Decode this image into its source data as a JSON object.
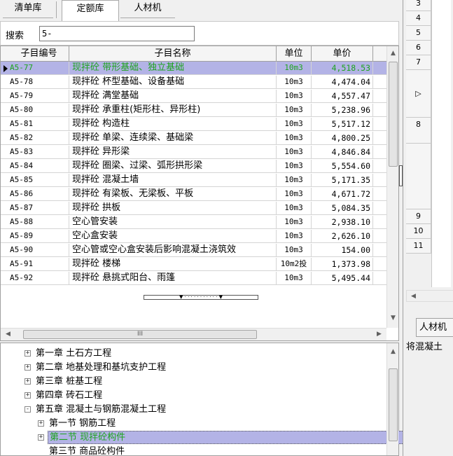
{
  "tabs": {
    "items": [
      "清单库",
      "定额库",
      "人材机"
    ],
    "active": 1
  },
  "search": {
    "label": "搜索",
    "value": "5-"
  },
  "grid": {
    "columns": [
      "子目编号",
      "子目名称",
      "单位",
      "单价"
    ],
    "selected_index": 0,
    "rows": [
      {
        "code": "A5-77",
        "name": "现拌砼 带形基础、独立基础",
        "unit": "10m3",
        "price": "4,518.53"
      },
      {
        "code": "A5-78",
        "name": "现拌砼 杯型基础、设备基础",
        "unit": "10m3",
        "price": "4,474.04"
      },
      {
        "code": "A5-79",
        "name": "现拌砼 满堂基础",
        "unit": "10m3",
        "price": "4,557.47"
      },
      {
        "code": "A5-80",
        "name": "现拌砼 承重柱(矩形柱、异形柱)",
        "unit": "10m3",
        "price": "5,238.96"
      },
      {
        "code": "A5-81",
        "name": "现拌砼 构造柱",
        "unit": "10m3",
        "price": "5,517.12"
      },
      {
        "code": "A5-82",
        "name": "现拌砼 单梁、连续梁、基础梁",
        "unit": "10m3",
        "price": "4,800.25"
      },
      {
        "code": "A5-83",
        "name": "现拌砼 异形梁",
        "unit": "10m3",
        "price": "4,846.84"
      },
      {
        "code": "A5-84",
        "name": "现拌砼 圈梁、过梁、弧形拱形梁",
        "unit": "10m3",
        "price": "5,554.60"
      },
      {
        "code": "A5-85",
        "name": "现拌砼 混凝土墙",
        "unit": "10m3",
        "price": "5,171.35"
      },
      {
        "code": "A5-86",
        "name": "现拌砼 有梁板、无梁板、平板",
        "unit": "10m3",
        "price": "4,671.72"
      },
      {
        "code": "A5-87",
        "name": "现拌砼 拱板",
        "unit": "10m3",
        "price": "5,084.35"
      },
      {
        "code": "A5-88",
        "name": "空心管安装",
        "unit": "10m3",
        "price": "2,938.10"
      },
      {
        "code": "A5-89",
        "name": "空心盒安装",
        "unit": "10m3",
        "price": "2,626.10"
      },
      {
        "code": "A5-90",
        "name": "空心管或空心盒安装后影响混凝土浇筑效",
        "unit": "10m3",
        "price": "154.00"
      },
      {
        "code": "A5-91",
        "name": "现拌砼 楼梯",
        "unit": "10m2投",
        "price": "1,373.98"
      },
      {
        "code": "A5-92",
        "name": "现拌砼 悬挑式阳台、雨篷",
        "unit": "10m3",
        "price": "5,495.44"
      }
    ],
    "hscroll_thumb_label": "III"
  },
  "tree": {
    "nodes": [
      {
        "label": "第一章 土石方工程",
        "level": 0,
        "expander": "+"
      },
      {
        "label": "第二章 地基处理和基坑支护工程",
        "level": 0,
        "expander": "+"
      },
      {
        "label": "第三章 桩基工程",
        "level": 0,
        "expander": "+"
      },
      {
        "label": "第四章 砖石工程",
        "level": 0,
        "expander": "+"
      },
      {
        "label": "第五章 混凝土与钢筋混凝土工程",
        "level": 0,
        "expander": "-"
      },
      {
        "label": "第一节  钢筋工程",
        "level": 1,
        "expander": "+"
      },
      {
        "label": "第二节  现拌砼构件",
        "level": 1,
        "expander": "+",
        "selected": true
      },
      {
        "label": "第三节  商品砼构件",
        "level": 1,
        "expander": ""
      }
    ]
  },
  "right_panel": {
    "row_numbers": [
      "3",
      "4",
      "5",
      "6",
      "7",
      "",
      "8",
      "",
      "9",
      "10",
      "11"
    ],
    "tab_label": "人材机",
    "text": "将混凝土"
  },
  "colors": {
    "selected_row_bg": "#b3b3e6",
    "selected_text": "#1ea31e"
  }
}
